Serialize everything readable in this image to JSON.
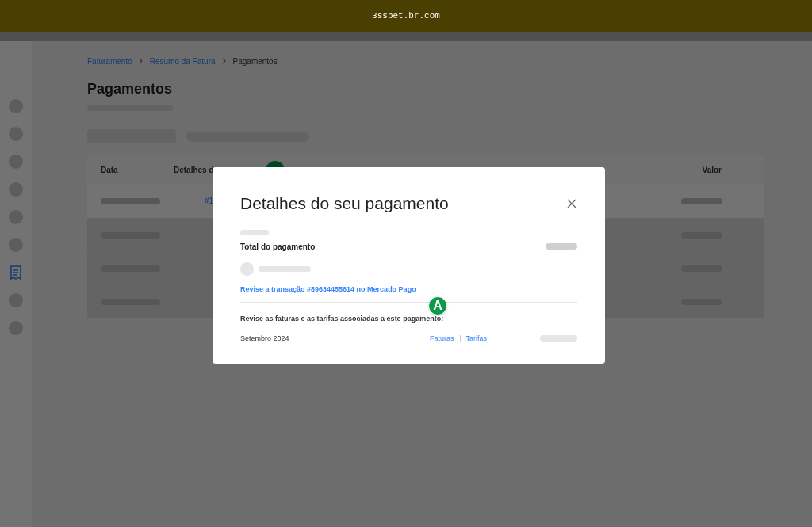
{
  "banner": {
    "title": "3ssbet.br.com"
  },
  "sidebar": {
    "items": [
      {
        "kind": "placeholder"
      },
      {
        "kind": "placeholder"
      },
      {
        "kind": "placeholder"
      },
      {
        "kind": "placeholder"
      },
      {
        "kind": "placeholder"
      },
      {
        "kind": "placeholder"
      },
      {
        "kind": "receipt",
        "selected": true
      },
      {
        "kind": "placeholder"
      },
      {
        "kind": "placeholder"
      }
    ]
  },
  "breadcrumb": [
    {
      "label": "Faturamento",
      "kind": "link"
    },
    {
      "label": "Resumo da Fatura",
      "kind": "link"
    },
    {
      "label": "Pagamentos",
      "kind": "current"
    }
  ],
  "page_title": "Pagamentos",
  "table": {
    "columns": [
      "Data",
      "Detalhes d",
      "Valor"
    ],
    "rows": [
      {
        "selected": true,
        "detail": "#1"
      },
      {
        "selected": false
      },
      {
        "selected": false
      },
      {
        "selected": false
      }
    ]
  },
  "modal": {
    "title": "Detalhes do seu pagamento",
    "total_label": "Total do pagamento",
    "transaction_link": "Revise a transação #89634455614 no Mercado Pago",
    "invoices_heading": "Revise as faturas e as tarifas associadas a este pagamento:",
    "marker": "A",
    "invoices": [
      {
        "period": "Setembro 2024",
        "links": [
          "Faturas",
          "Tarifas"
        ]
      }
    ]
  }
}
